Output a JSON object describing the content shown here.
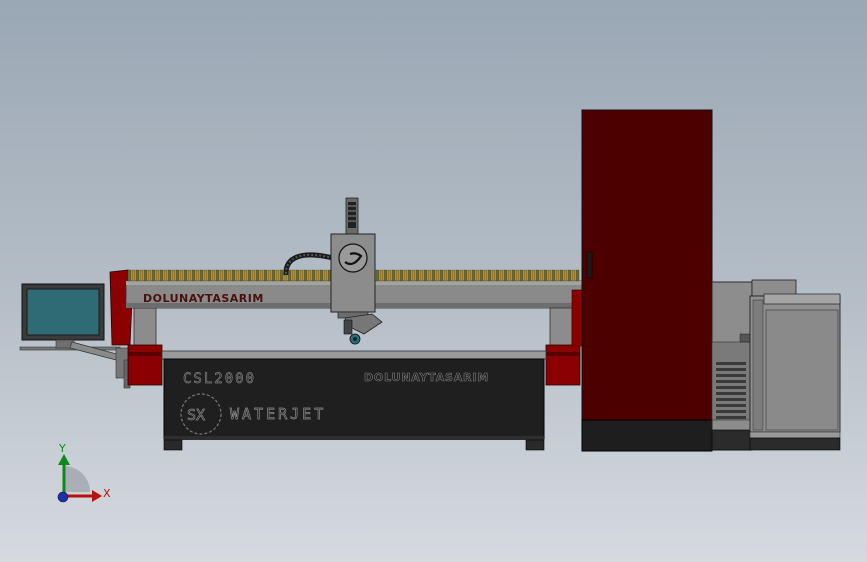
{
  "scene": {
    "gantry_brand": "DOLUNAYTASARIM",
    "table_model": "CSL2000",
    "table_brand": "DOLUNAYTASARIM",
    "logo_mark": "SX",
    "table_product": "WATERJET"
  },
  "triad": {
    "x_label": "X",
    "y_label": "Y"
  },
  "colors": {
    "background_top": "#9aa7b4",
    "background_bottom": "#d6dadf",
    "cabinet": "#4d0000",
    "accent_red": "#8b0000",
    "body_gray": "#858585",
    "table_black": "#1f1f1f",
    "screen": "#2f6b75"
  }
}
